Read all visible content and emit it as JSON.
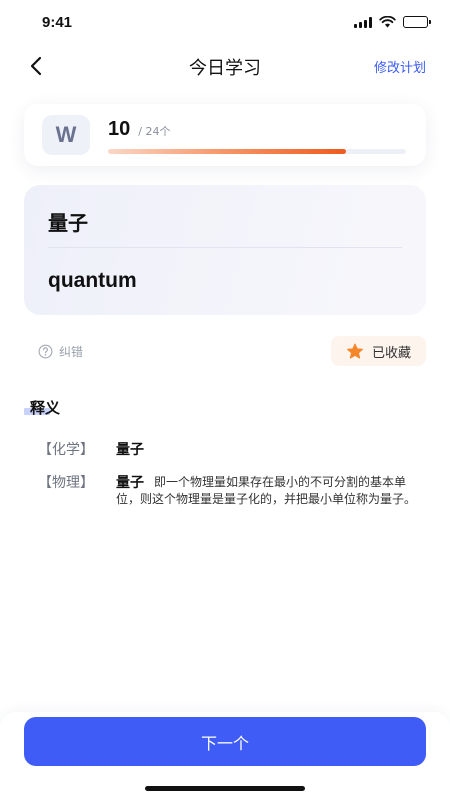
{
  "status_bar": {
    "time": "9:41",
    "icons": [
      "signal-icon",
      "wifi-icon",
      "battery-icon"
    ]
  },
  "nav": {
    "title": "今日学习",
    "action_label": "修改计划",
    "back_icon": "chevron-left-icon"
  },
  "progress": {
    "letter": "W",
    "current": "10",
    "total_label": "/ 24个",
    "fraction": 0.8
  },
  "word": {
    "chinese": "量子",
    "english": "quantum"
  },
  "actions": {
    "report_label": "纠错",
    "report_icon": "question-circle-icon",
    "favorite_label": "已收藏",
    "favorite_icon": "star-icon"
  },
  "definitions": {
    "heading": "释义",
    "items": [
      {
        "tag": "【化学】",
        "term": "量子",
        "description": ""
      },
      {
        "tag": "【物理】",
        "term": "量子",
        "description": "即一个物理量如果存在最小的不可分割的基本单位，则这个物理量是量子化的，并把最小单位称为量子。"
      }
    ]
  },
  "footer": {
    "next_label": "下一个"
  },
  "colors": {
    "accent": "#3f5cf6",
    "link": "#3b5bf5",
    "progress_end": "#ee5a1c",
    "star": "#f5862a"
  }
}
